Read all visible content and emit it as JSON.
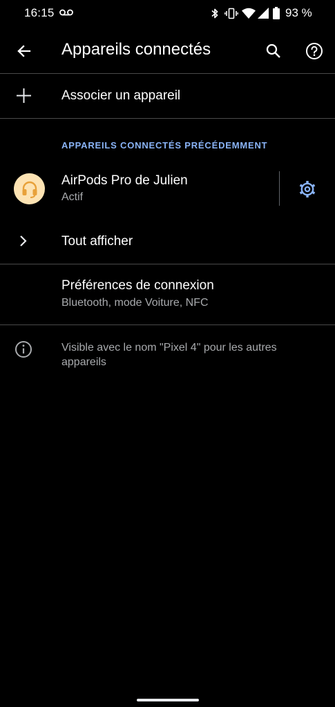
{
  "status_bar": {
    "time": "16:15",
    "battery": "93 %",
    "icons": [
      "voicemail-icon",
      "bluetooth-icon",
      "vibrate-icon",
      "wifi-icon",
      "signal-icon",
      "battery-icon"
    ]
  },
  "app_bar": {
    "title": "Appareils connectés",
    "icons": [
      "back-arrow-icon",
      "search-icon",
      "help-icon"
    ]
  },
  "pair": {
    "label": "Associer un appareil",
    "icon": "plus-icon"
  },
  "section": {
    "header": "APPAREILS CONNECTÉS PRÉCÉDEMMENT"
  },
  "device": {
    "name": "AirPods Pro de Julien",
    "status": "Actif",
    "icon": "headset-icon",
    "settings_icon": "gear-icon"
  },
  "show_all": {
    "label": "Tout afficher",
    "icon": "chevron-right-icon"
  },
  "connection_prefs": {
    "title": "Préférences de connexion",
    "subtitle": "Bluetooth, mode Voiture, NFC"
  },
  "info": {
    "text": "Visible avec le nom \"Pixel 4\" pour les autres appareils",
    "icon": "info-icon"
  },
  "colors": {
    "background": "#000000",
    "accent": "#8ab4f8",
    "avatar_bg": "#fde3b3",
    "avatar_fg": "#e8a13a",
    "divider": "#4a4a4a"
  }
}
